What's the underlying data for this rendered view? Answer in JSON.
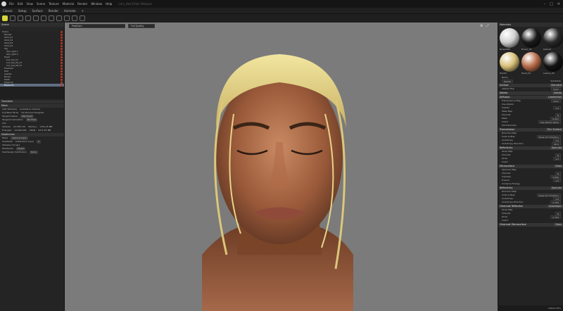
{
  "titlebar": {
    "menu": [
      "File",
      "Edit",
      "View",
      "Scene",
      "Texture",
      "Material",
      "Render",
      "Window",
      "Help"
    ],
    "doc": "Lars_Hair2/Hair.Weepee"
  },
  "tabs": [
    "Classic",
    "Setup",
    "Surface",
    "Render",
    "Animate",
    "+"
  ],
  "scene": {
    "header": "Scene",
    "items": [
      {
        "label": "Scene",
        "highlight": false
      },
      {
        "label": "Render",
        "highlight": false
      },
      {
        "label": "Shot_01",
        "highlight": false
      },
      {
        "label": "Shot_02",
        "highlight": false
      },
      {
        "label": "Shot_03",
        "highlight": false
      },
      {
        "label": "Shot_04",
        "highlight": false
      },
      {
        "label": "Sky",
        "highlight": false
      },
      {
        "label": "Sky Light 1",
        "highlight": false
      },
      {
        "label": "Sky Light 2",
        "highlight": false
      },
      {
        "label": "Head",
        "highlight": false
      },
      {
        "label": "Cut_Gel_07",
        "highlight": false
      },
      {
        "label": "Cut_Gel_06_07",
        "highlight": false
      },
      {
        "label": "Cut_Gel_08_07",
        "highlight": false
      },
      {
        "label": "FreeCam",
        "highlight": false
      },
      {
        "label": "Hair",
        "highlight": false
      },
      {
        "label": "Lashes",
        "highlight": false
      },
      {
        "label": "Brows",
        "highlight": false
      },
      {
        "label": "Teeth",
        "highlight": false
      },
      {
        "label": "Eyebrow",
        "highlight": false
      },
      {
        "label": "Head.2m",
        "highlight": true
      }
    ]
  },
  "transform": {
    "header": "Transform"
  },
  "mesh": {
    "header": "Mesh",
    "cast_shadows": "Cast Shadows",
    "cast_shadows_val": "Invisible to Camera",
    "cull": "Cull Back Faces",
    "cull_val": "Fix Mirrored Tangents",
    "tangent_space": "Tangent Space",
    "tangent_space_val": "Marmoset",
    "tangent_calc": "Tangent Calculation",
    "tangent_calc_val": "Per Pixel",
    "info": "Info",
    "vertices_label": "Vertices",
    "vertices": "22,378,710",
    "memory_label": "Memory",
    "memory": "1791.25 MB",
    "triangles_label": "Triangles",
    "triangles": "24,990,994",
    "vram_label": "VRAM",
    "vram": "5271.81 MB"
  },
  "subdivision": {
    "header": "Subdivision",
    "mode_label": "Mode",
    "mode": "Catmull-Clark",
    "subdivide": "Subdivide",
    "subdivision_level_label": "Subdivision Level",
    "subdivision_level": "0",
    "sharpen_corners": "Sharpen Corners",
    "wireframe_label": "Wireframe",
    "wireframe": "Inherit",
    "seamless_label": "Seamlessly Subdivision",
    "seamless": "None"
  },
  "viewport": {
    "camera": "FreeCam",
    "quality": "Full Quality"
  },
  "materials": {
    "header": "Materials",
    "spheres": [
      {
        "name": "BodyInMV",
        "color": "#cfcfcf"
      },
      {
        "name": "Brows_03",
        "color": "#1a1a1a"
      },
      {
        "name": "Default",
        "color": "#2a2a2a"
      },
      {
        "name": "Hair02",
        "color": "#d8c078"
      },
      {
        "name": "Head_03",
        "color": "#b86c4a"
      },
      {
        "name": "Lashes_04",
        "color": "#141414"
      }
    ]
  },
  "props": {
    "name_label": "Name",
    "name_val": "Hair02",
    "subdivision_val": "Subdivide",
    "sections": [
      {
        "header": "Surface",
        "val": "Standard"
      },
      {
        "header": "Albedo",
        "val": "Albedo"
      },
      {
        "header": "Diffusion",
        "val": "Lambertian"
      },
      {
        "header": "Transmission",
        "val": "Thin Surface"
      },
      {
        "header": "Reflectivity",
        "val": "Specular"
      },
      {
        "header": "Microsurface",
        "val": "Gloss"
      },
      {
        "header": "Reflectivity",
        "val": "Specular"
      },
      {
        "header": "Clearcoat Reflection",
        "val": "Anisotropic"
      },
      {
        "header": "Clearcoat Microsurface",
        "val": "Gloss"
      }
    ],
    "albedo_map": "Albedo Map",
    "color": "Color",
    "transmission_map": "Translucency Map",
    "use_albedo": "Use Albedo",
    "scatter": "Scatter",
    "scatter_val": "1.0",
    "mask_map": "Mask Map",
    "channel": "Channel",
    "channel_val": "R",
    "mask": "Mask",
    "mask_val": "0.001",
    "invert": "Invert",
    "use_albedo_alpha": "Use Albedo Alpha",
    "shirt_normals": "Shirt Normals",
    "direction_map": "Direction Map",
    "scale_bias": "Scale & Bias",
    "swap_xy": "Swap X/Y Direction",
    "anisotropy": "Anisotropy",
    "anisotropy_val": "1.0",
    "aniso_direction": "Anisotropy Direction",
    "aniso_direction_val": "90.0",
    "gloss_map": "Gloss Map",
    "gloss": "Gloss",
    "gloss_val": "1.0",
    "specular_map": "Specular Map",
    "intensity": "Intensity",
    "intensity_val": "0.050",
    "fresnel": "Fresnel",
    "fresnel_val": "1.0",
    "conserve_energy": "Conserve Energy",
    "aniso_direction_2_val": "0.700",
    "gloss_2_val": "0.700"
  },
  "status": "USDAX  60%",
  "colors": {
    "accent": "#d6d63a",
    "highlight": "#5f6f82",
    "viewport_bg": "#7b7b7b",
    "hair_swatch": "#e6d08a"
  }
}
